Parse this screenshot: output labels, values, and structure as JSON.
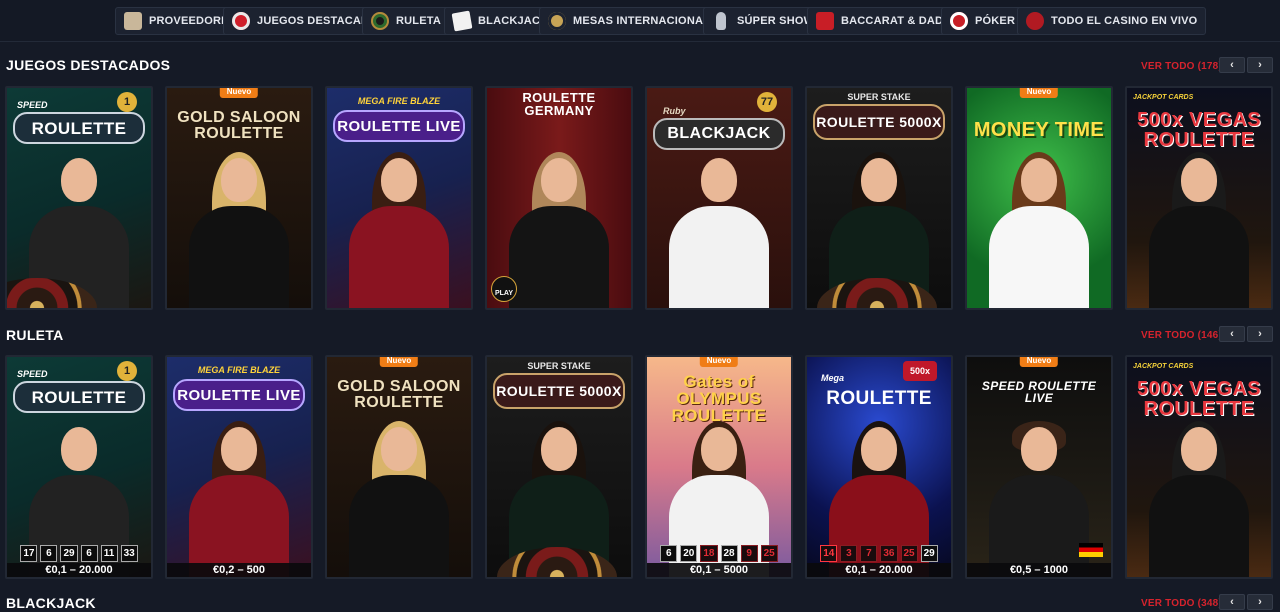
{
  "nav": [
    {
      "label": "PROVEEDORES",
      "icon": "providers-icon"
    },
    {
      "label": "JUEGOS DESTACADOS",
      "icon": "chip-icon"
    },
    {
      "label": "RULETA",
      "icon": "roulette-wheel-icon"
    },
    {
      "label": "BLACKJACK",
      "icon": "cards-icon"
    },
    {
      "label": "MESAS INTERNACIONALES",
      "icon": "globe-icon"
    },
    {
      "label": "SÚPER SHOWS",
      "icon": "microphone-icon"
    },
    {
      "label": "BACCARAT & DADOS",
      "icon": "dice-icon"
    },
    {
      "label": "PÓKER",
      "icon": "poker-chip-icon"
    },
    {
      "label": "TODO EL CASINO EN VIVO",
      "icon": "live-casino-icon"
    }
  ],
  "arrows": {
    "prev": "‹",
    "next": "›"
  },
  "sections": [
    {
      "title": "JUEGOS DESTACADOS",
      "ver_todo": "VER TODO (178)",
      "cards": [
        {
          "subtitle": "SPEED",
          "logo": "ROULETTE",
          "chip": "1"
        },
        {
          "badge": "Nuevo",
          "logo": "GOLD SALOON ROULETTE"
        },
        {
          "subtitle": "MEGA FIRE BLAZE",
          "logo": "ROULETTE LIVE"
        },
        {
          "logo": "ROULETTE GERMANY",
          "play": "PLAY"
        },
        {
          "subtitle": "Ruby",
          "logo": "BLACKJACK",
          "chip": "77"
        },
        {
          "subtitle": "SUPER STAKE",
          "logo": "ROULETTE 5000X"
        },
        {
          "badge": "Nuevo",
          "logo": "MONEY TIME"
        },
        {
          "subtitle": "JACKPOT CARDS",
          "logo": "500x VEGAS ROULETTE"
        }
      ]
    },
    {
      "title": "RULETA",
      "ver_todo": "VER TODO (146)",
      "cards": [
        {
          "subtitle": "SPEED",
          "logo": "ROULETTE",
          "chip": "1",
          "numbers": [
            "17",
            "6",
            "29",
            "6",
            "11",
            "33"
          ],
          "stake": "€0,1 – 20.000"
        },
        {
          "subtitle": "MEGA FIRE BLAZE",
          "logo": "ROULETTE LIVE",
          "stake": "€0,2 – 500"
        },
        {
          "badge": "Nuevo",
          "logo": "GOLD SALOON ROULETTE"
        },
        {
          "subtitle": "SUPER STAKE",
          "logo": "ROULETTE 5000X"
        },
        {
          "badge": "Nuevo",
          "logo": "Gates of OLYMPUS ROULETTE",
          "numbers": [
            "6",
            "20",
            "18",
            "28",
            "9",
            "25"
          ],
          "stake": "€0,1 – 5000"
        },
        {
          "subtitle": "Mega",
          "logo": "ROULETTE",
          "chip": "500x",
          "numbers": [
            "14",
            "3",
            "7",
            "36",
            "25",
            "29"
          ],
          "stake": "€0,1 – 20.000"
        },
        {
          "badge": "Nuevo",
          "logo": "SPEED ROULETTE LIVE",
          "stake": "€0,5 – 1000"
        },
        {
          "subtitle": "JACKPOT CARDS",
          "logo": "500x VEGAS ROULETTE"
        }
      ]
    },
    {
      "title": "BLACKJACK",
      "ver_todo": "VER TODO (348)"
    }
  ],
  "colors": {
    "accent": "#d6232d",
    "new_badge": "#f07d16",
    "background": "#151a26"
  }
}
